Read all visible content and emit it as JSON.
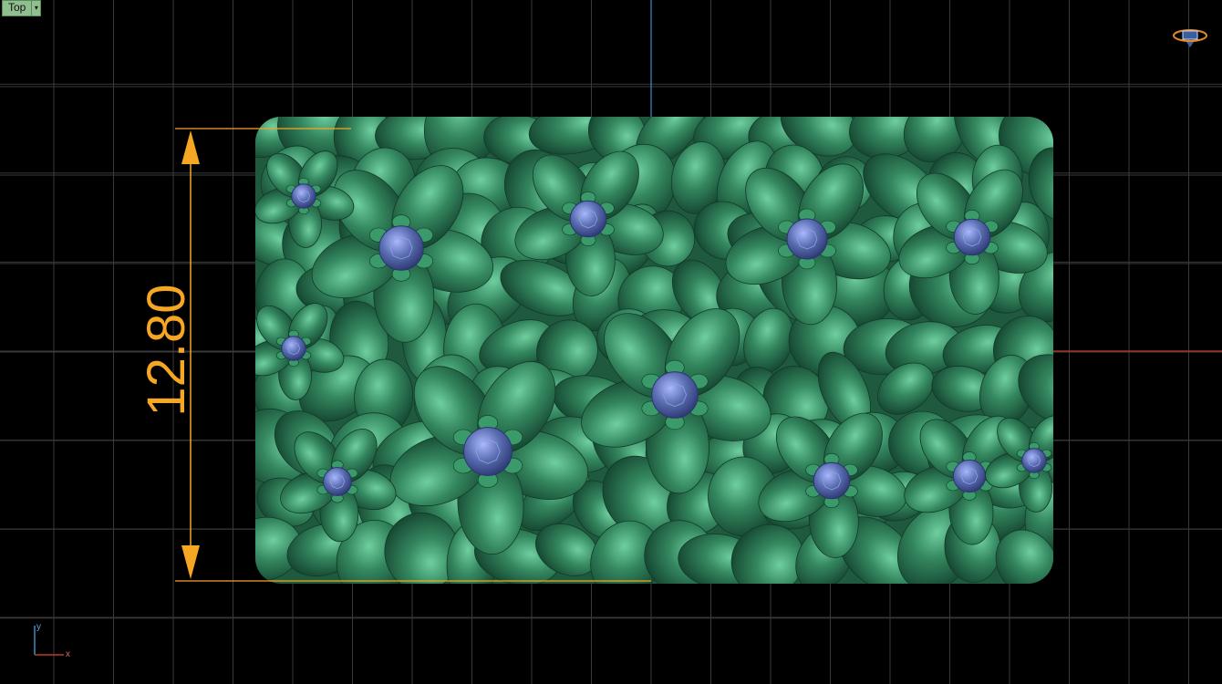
{
  "viewport": {
    "name": "Top",
    "dropdown_icon": "caret-down-icon",
    "grid_visible": true
  },
  "dimension": {
    "value": "12.80",
    "color": "#f5a623"
  },
  "axes": {
    "x_label": "x",
    "y_label": "y",
    "x_color": "#c0392b",
    "y_color": "#3b8fc4"
  },
  "model": {
    "body_color": "#2f7a55",
    "gem_color": "#5a6db0",
    "icon": "flower-ring-model"
  },
  "view_widget": {
    "icon": "view-cube-icon",
    "color": "#e08a2a"
  }
}
